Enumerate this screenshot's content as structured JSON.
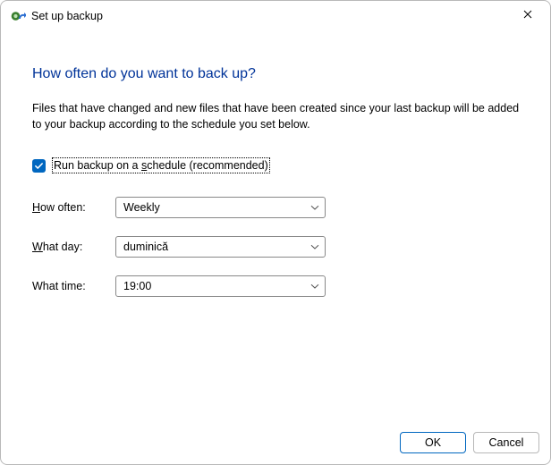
{
  "window": {
    "title": "Set up backup"
  },
  "page": {
    "heading": "How often do you want to back up?",
    "description": "Files that have changed and new files that have been created since your last backup will be added to your backup according to the schedule you set below."
  },
  "schedule": {
    "checkbox_checked": true,
    "checkbox_label_pre": "Run backup on a ",
    "checkbox_label_key": "s",
    "checkbox_label_post": "chedule (recommended)"
  },
  "fields": {
    "how_often": {
      "label_pre": "H",
      "label_post": "ow often:",
      "value": "Weekly"
    },
    "what_day": {
      "label_pre": "W",
      "label_post": "hat day:",
      "value": "duminică"
    },
    "what_time": {
      "label": "What time:",
      "value": "19:00"
    }
  },
  "footer": {
    "ok": "OK",
    "cancel": "Cancel"
  }
}
